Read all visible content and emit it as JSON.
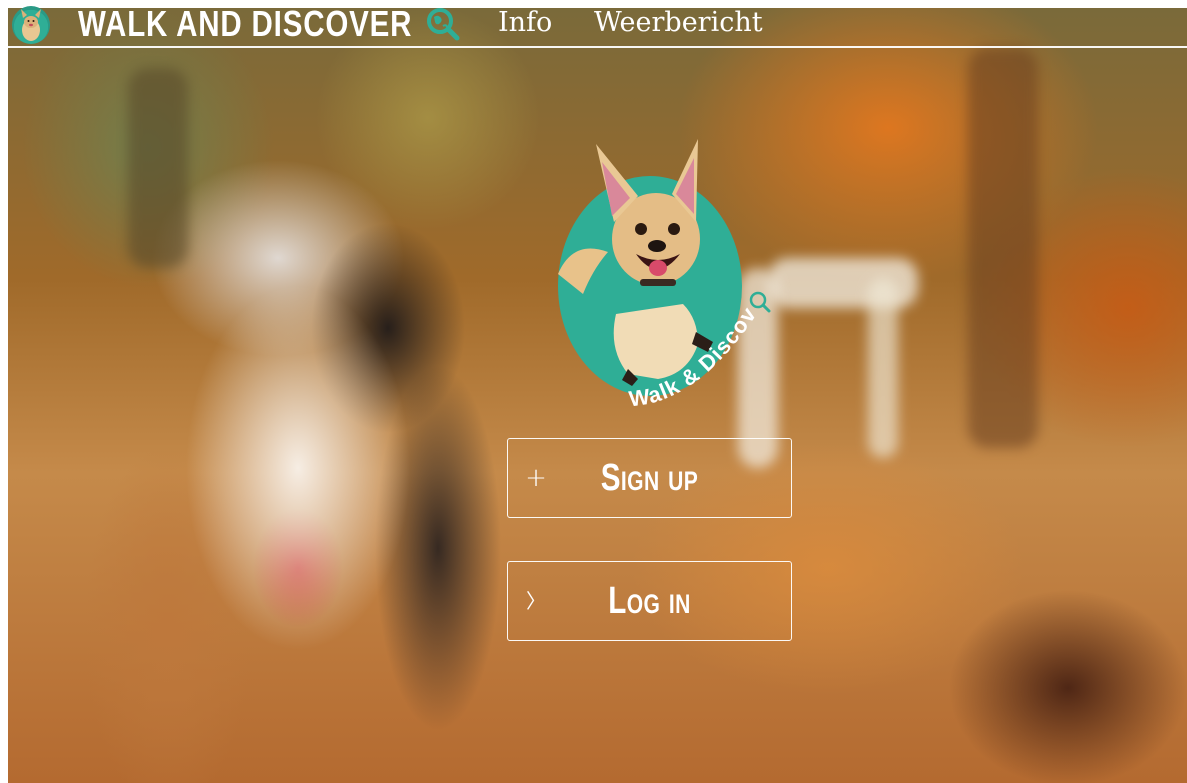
{
  "header": {
    "brand_title": "WALK AND DISCOVER",
    "brand_icon": "magnifier-globe-icon",
    "nav": [
      {
        "label": "Info"
      },
      {
        "label": "Weerbericht"
      }
    ]
  },
  "hero": {
    "logo_text": "Walk & Discover",
    "logo_icon": "dog-logo",
    "accent_color": "#2fae96"
  },
  "actions": {
    "signup": {
      "label": "Sign up",
      "icon": "plus-icon",
      "glyph": "+"
    },
    "login": {
      "label": "Log in",
      "icon": "chevron-right-icon",
      "glyph": "〉"
    }
  }
}
